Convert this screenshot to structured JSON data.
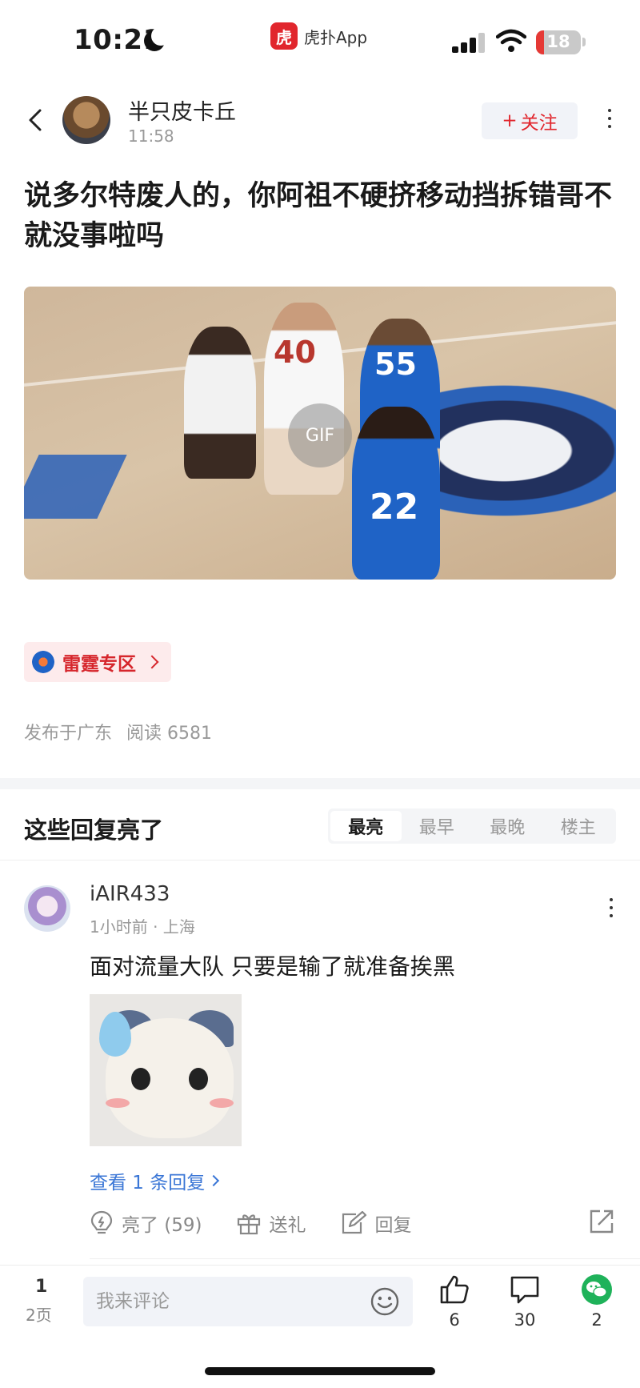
{
  "status_bar": {
    "time": "10:21",
    "app_name": "虎扑App",
    "app_logo_text": "虎",
    "battery": "18"
  },
  "header": {
    "author": "半只皮卡丘",
    "post_time": "11:58",
    "follow_label": "关注",
    "follow_plus": "+"
  },
  "post": {
    "title": "说多尔特废人的，你阿祖不硬挤移动挡拆错哥不就没事啦吗",
    "gif_label": "GIF",
    "jerseys": [
      "40",
      "55",
      "22"
    ],
    "zone_label": "雷霆专区",
    "location": "发布于广东",
    "reads": "阅读 6581"
  },
  "replies": {
    "title": "这些回复亮了",
    "tabs": [
      "最亮",
      "最早",
      "最晚",
      "楼主"
    ]
  },
  "comment": {
    "user": "iAIR433",
    "meta": "1小时前 · 上海",
    "text": "面对流量大队 只要是输了就准备挨黑",
    "view_replies": "查看 1 条回复",
    "light_label": "亮了 (59)",
    "gift_label": "送礼",
    "reply_label": "回复"
  },
  "bottom_bar": {
    "page_current": "1",
    "page_total": "2页",
    "input_placeholder": "我来评论",
    "likes": "6",
    "comments": "30",
    "shares": "2"
  },
  "colors": {
    "brand": "#e1262d",
    "link": "#3a76d6",
    "wechat": "#1fb25a"
  }
}
